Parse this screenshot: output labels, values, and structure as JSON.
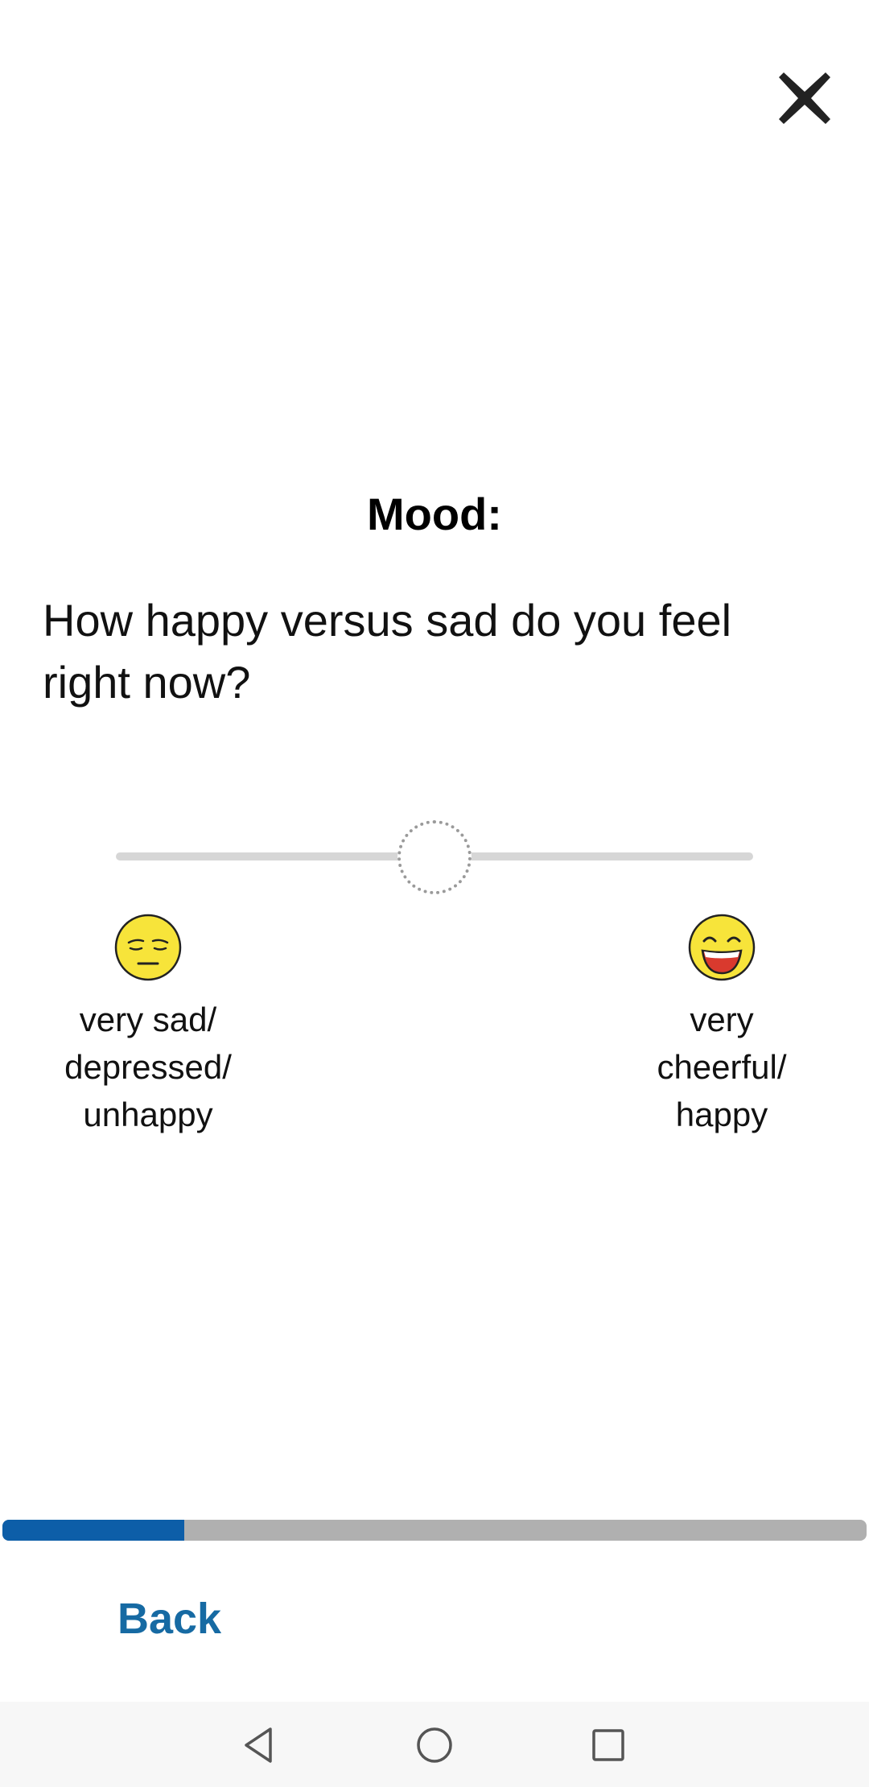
{
  "header": {
    "close_icon": "close-x-icon"
  },
  "question": {
    "title": "Mood:",
    "text": "How happy versus sad do you feel right now?"
  },
  "slider": {
    "value_fraction": 0.5,
    "track_color": "#d6d6d6",
    "thumb_style": "dotted-circle"
  },
  "anchors": {
    "left": {
      "icon": "sad-face-icon",
      "lines": [
        "very sad/",
        "depressed/",
        "unhappy"
      ]
    },
    "right": {
      "icon": "grinning-face-icon",
      "lines": [
        "very",
        "cheerful/",
        "happy"
      ]
    }
  },
  "progress": {
    "fraction": 0.21,
    "fill_color": "#0d5ea8",
    "track_color": "#b0b0b0"
  },
  "footer": {
    "back_label": "Back"
  },
  "navbar": {
    "icons": [
      "back-triangle-icon",
      "home-circle-icon",
      "recents-square-icon"
    ]
  }
}
